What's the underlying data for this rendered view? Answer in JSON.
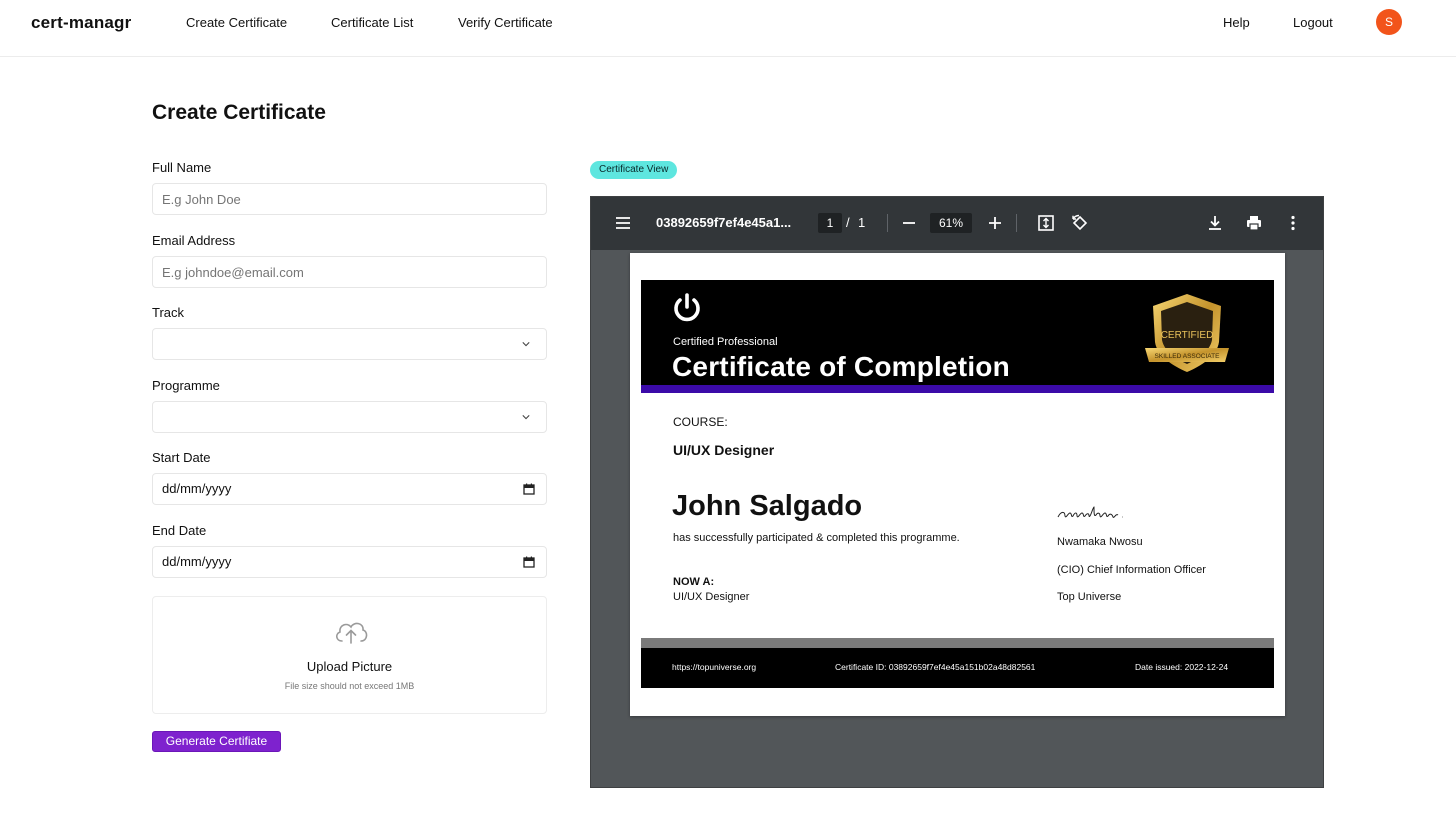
{
  "nav": {
    "brand": "cert-managr",
    "links": [
      "Create Certificate",
      "Certificate List",
      "Verify Certificate"
    ],
    "help": "Help",
    "logout": "Logout",
    "avatar_initial": "S",
    "avatar_color": "#f2541b"
  },
  "form": {
    "title": "Create Certificate",
    "full_name": {
      "label": "Full Name",
      "placeholder": "E.g John Doe"
    },
    "email": {
      "label": "Email Address",
      "placeholder": "E.g johndoe@email.com"
    },
    "track": {
      "label": "Track",
      "value": ""
    },
    "programme": {
      "label": "Programme",
      "value": ""
    },
    "start_date": {
      "label": "Start Date",
      "value": "dd/mm/yyyy"
    },
    "end_date": {
      "label": "End Date",
      "value": "dd/mm/yyyy"
    },
    "upload": {
      "title": "Upload Picture",
      "hint": "File size should not exceed 1MB",
      "icon": "cloud-upload-icon"
    },
    "submit_label": "Generate Certifiate",
    "accent_color": "#7e22ce"
  },
  "viewer": {
    "badge": "Certificate View",
    "filename": "03892659f7ef4e45a1...",
    "page_current": "1",
    "page_separator": "/",
    "page_total": "1",
    "zoom": "61%",
    "icons": [
      "menu-icon",
      "zoom-out-icon",
      "zoom-in-icon",
      "fit-page-icon",
      "rotate-icon",
      "download-icon",
      "print-icon",
      "more-vert-icon"
    ]
  },
  "certificate": {
    "subtitle": "Certified Professional",
    "title": "Certificate of Completion",
    "course_label": "COURSE:",
    "course": "UI/UX Designer",
    "recipient": "John Salgado",
    "statement": "has successfully participated & completed this programme.",
    "now_label": "NOW A:",
    "now_value": "UI/UX Designer",
    "signer_name": "Nwamaka Nwosu",
    "signer_role": "(CIO) Chief Information Officer",
    "signer_org": "Top Universe",
    "badge_text": "CERTIFIED",
    "badge_ribbon": "SKILLED ASSOCIATE",
    "website": "https://topuniverse.org",
    "cert_id": "Certificate ID: 03892659f7ef4e45a151b02a48d82561",
    "date_issued": "Date issued: 2022-12-24",
    "header_stripe_color": "#3b0aa8"
  }
}
